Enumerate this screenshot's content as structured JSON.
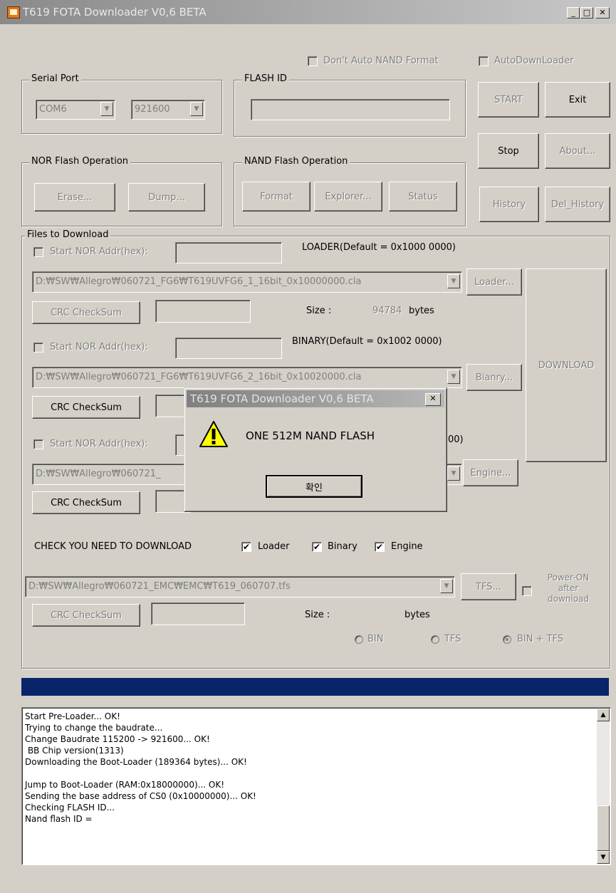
{
  "window": {
    "title": "T619 FOTA Downloader V0,6 BETA",
    "minimize": "_",
    "maximize": "□",
    "close": "✕"
  },
  "top_options": {
    "dont_auto_nand": "Don't Auto NAND Format",
    "auto_downloader": "AutoDownLoader"
  },
  "serial_port": {
    "label": "Serial Port",
    "port": "COM6",
    "baud": "921600"
  },
  "flash_id": {
    "label": "FLASH ID",
    "value": ""
  },
  "buttons": {
    "start": "START",
    "exit": "Exit",
    "stop": "Stop",
    "about": "About...",
    "history": "History",
    "del_history": "Del_History",
    "download": "DOWNLOAD"
  },
  "nor": {
    "label": "NOR Flash Operation",
    "erase": "Erase...",
    "dump": "Dump..."
  },
  "nand": {
    "label": "NAND Flash Operation",
    "format": "Format",
    "explorer": "Explorer...",
    "status": "Status"
  },
  "files": {
    "label": "Files to Download",
    "loader": {
      "start_addr_label": "Start NOR Addr(hex):",
      "default_label": "LOADER(Default = 0x1000 0000)",
      "path": "D:₩SW₩Allegro₩060721_FG6₩T619UVFG6_1_16bit_0x10000000.cla",
      "browse": "Loader...",
      "crc": "CRC CheckSum",
      "size_label": "Size :",
      "size_value": "94784",
      "size_unit": "bytes"
    },
    "binary": {
      "start_addr_label": "Start NOR Addr(hex):",
      "default_label": "BINARY(Default = 0x1002 0000)",
      "path": "D:₩SW₩Allegro₩060721_FG6₩T619UVFG6_2_16bit_0x10020000.cla",
      "browse": "Bianry...",
      "crc": "CRC CheckSum"
    },
    "engine": {
      "start_addr_label": "Start NOR Addr(hex):",
      "default_tail": "00)",
      "path": "D:₩SW₩Allegro₩060721_",
      "browse": "Engine...",
      "crc": "CRC CheckSum"
    },
    "check_label": "CHECK YOU NEED TO DOWNLOAD",
    "check_loader": "Loader",
    "check_binary": "Binary",
    "check_engine": "Engine",
    "tfs": {
      "path": "D:₩SW₩Allegro₩060721_EMC₩EMC₩T619_060707.tfs",
      "browse": "TFS...",
      "crc": "CRC CheckSum",
      "size_label": "Size :",
      "size_unit": "bytes",
      "power_on": "Power-ON after download",
      "radio_bin": "BIN",
      "radio_tfs": "TFS",
      "radio_both": "BIN + TFS"
    }
  },
  "log": {
    "lines": [
      "Start Pre-Loader... OK!",
      "Trying to change the baudrate...",
      "Change Baudrate 115200 -> 921600... OK!",
      " BB Chip version(1313)",
      "Downloading the Boot-Loader (189364 bytes)... OK!",
      "",
      "Jump to Boot-Loader (RAM:0x18000000)... OK!",
      "Sending the base address of CS0 (0x10000000)... OK!",
      "Checking FLASH ID...",
      "Nand flash ID ="
    ]
  },
  "dialog": {
    "title": "T619 FOTA Downloader V0,6 BETA",
    "message": "ONE 512M NAND FLASH",
    "ok": "확인",
    "close": "✕"
  },
  "colors": {
    "face": "#d4d0c8",
    "progress": "#0a246a"
  }
}
